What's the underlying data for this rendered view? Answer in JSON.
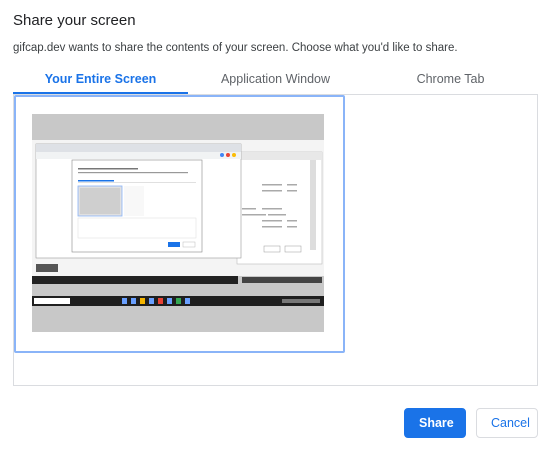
{
  "dialog": {
    "title": "Share your screen",
    "subtitle": "gifcap.dev wants to share the contents of your screen. Choose what you'd like to share."
  },
  "tabs": [
    {
      "label": "Your Entire Screen",
      "active": true
    },
    {
      "label": "Application Window",
      "active": false
    },
    {
      "label": "Chrome Tab",
      "active": false
    }
  ],
  "actions": {
    "share_label": "Share",
    "cancel_label": "Cancel"
  },
  "colors": {
    "accent": "#1a73e8",
    "selection_border": "#8ab4f8"
  }
}
